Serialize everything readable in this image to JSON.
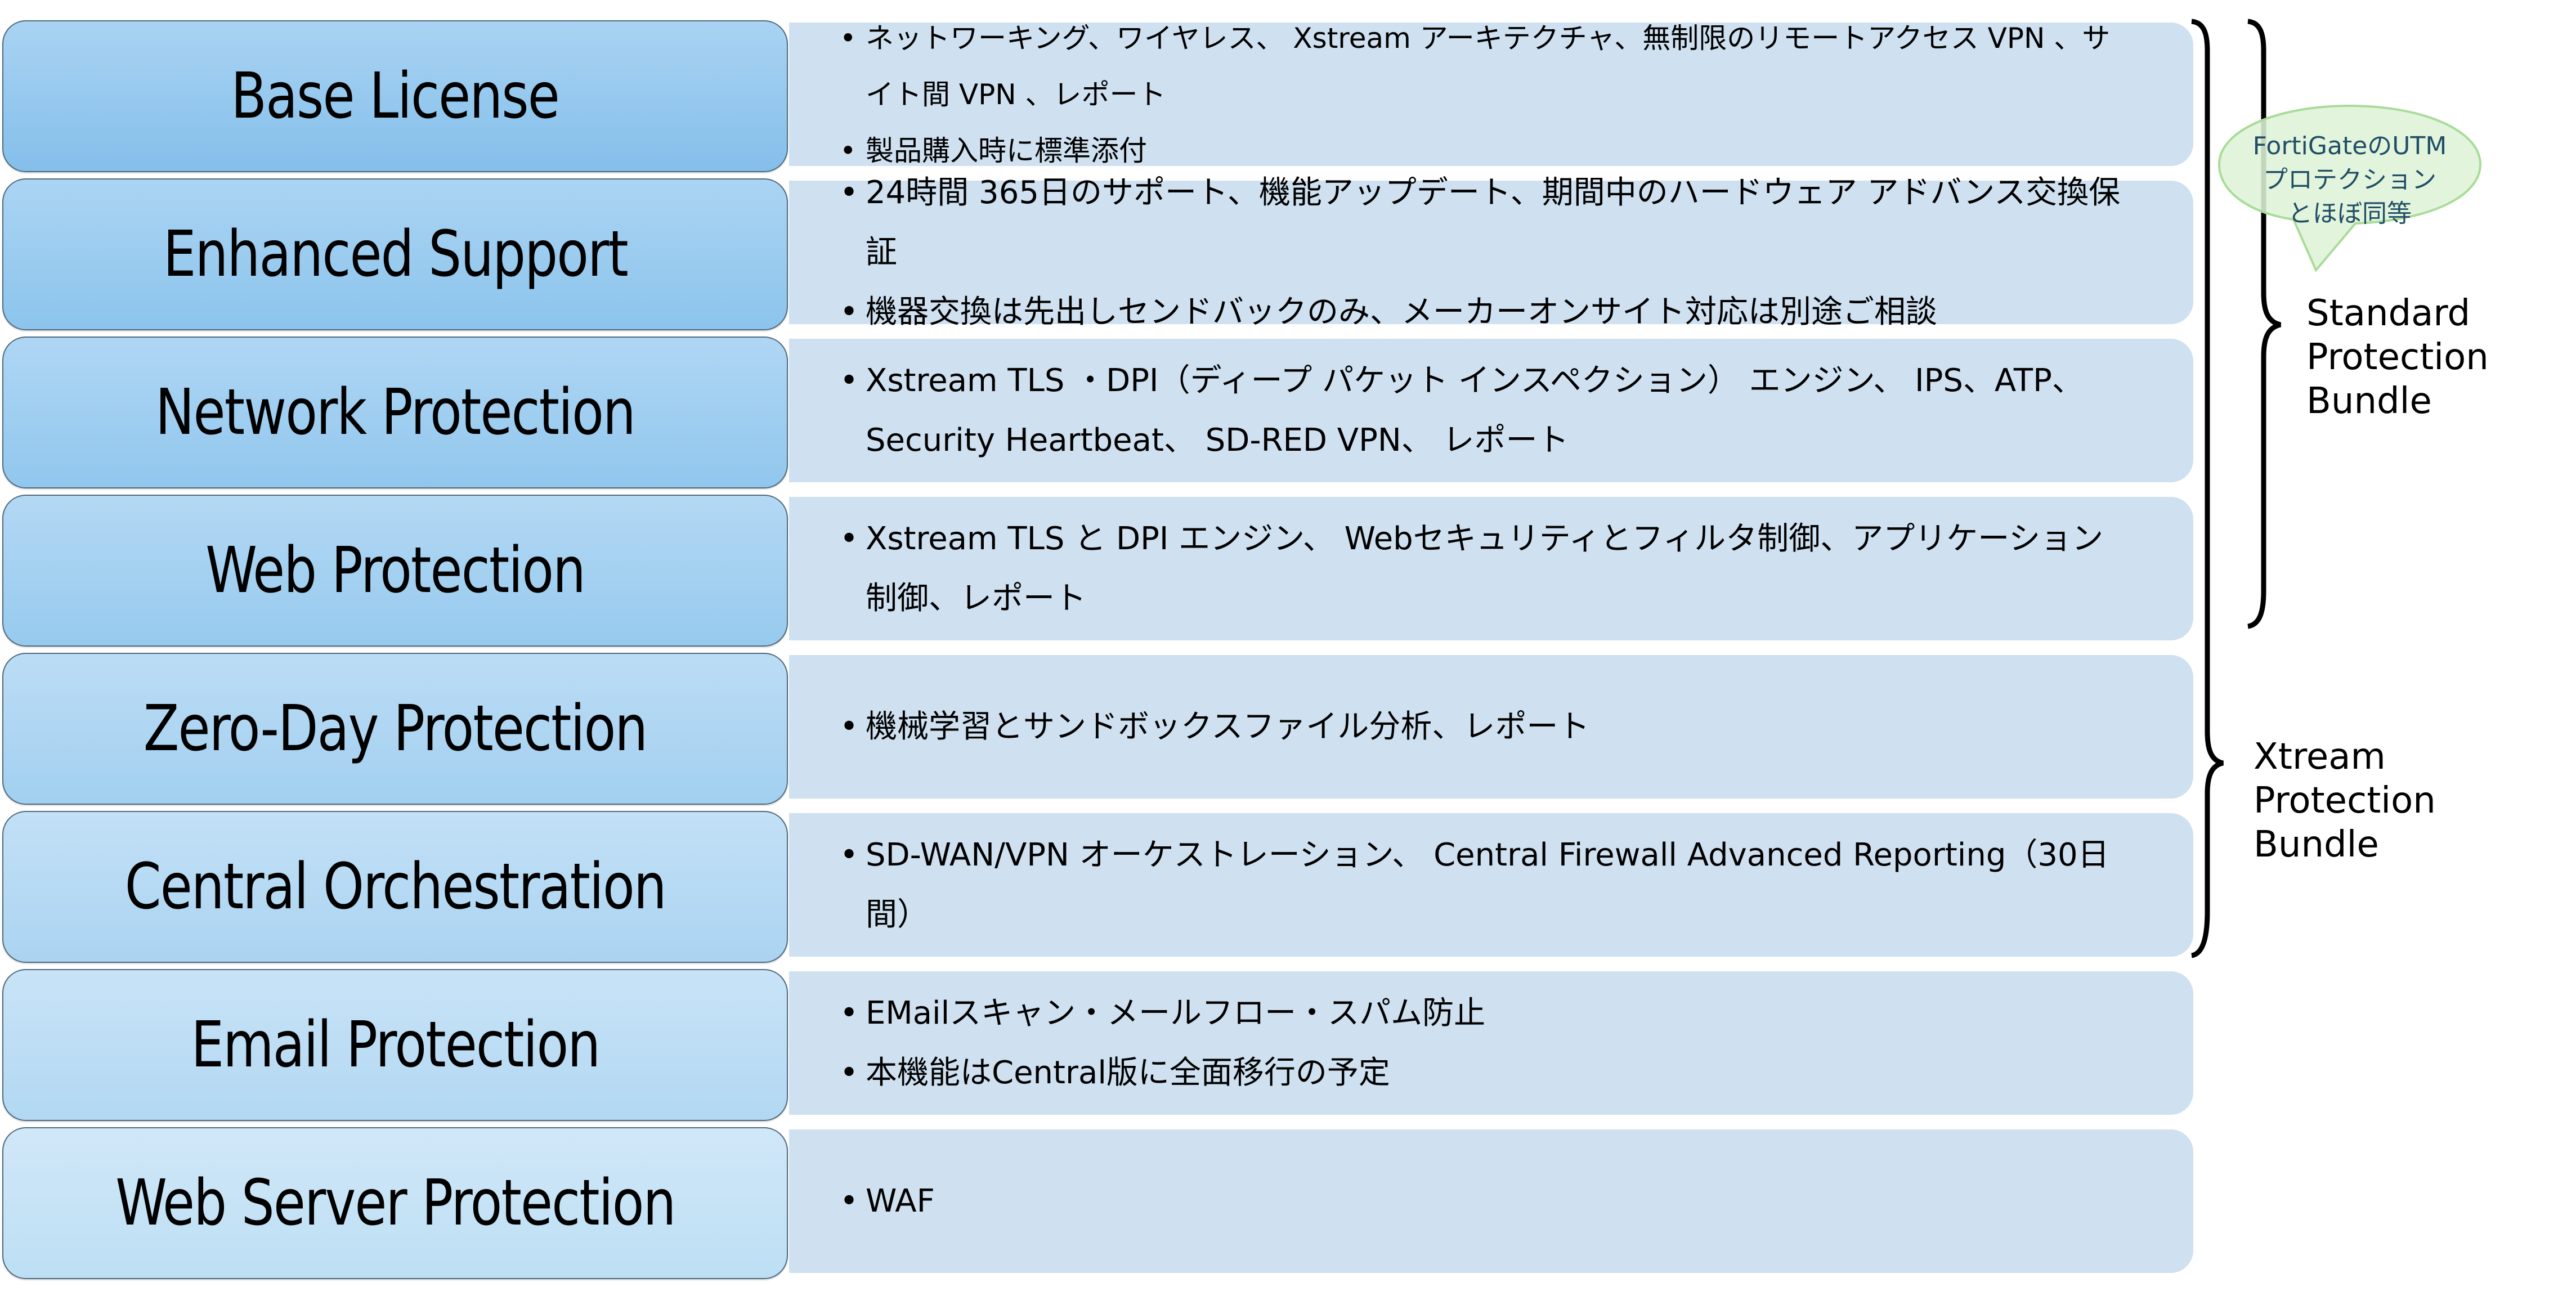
{
  "rows": [
    {
      "label": "Base License",
      "gradient": [
        "#a9d3f3",
        "#84bfea"
      ],
      "bullets": [
        "ネットワーキング、ワイヤレス、 Xstream アーキテクチャ、無制限のリモートアクセス VPN 、サイト間 VPN 、レポート",
        "製品購入時に標準添付"
      ]
    },
    {
      "label": "Enhanced Support",
      "gradient": [
        "#abd4f3",
        "#8cc4ec"
      ],
      "bullets": [
        "24時間 365日のサポート、機能アップデート、期間中のハードウェア アドバンス交換保証",
        "機器交換は先出しセンドバックのみ、メーカーオンサイト対応は別途ご相談"
      ]
    },
    {
      "label": "Network Protection",
      "gradient": [
        "#afd6f4",
        "#91c7ed"
      ],
      "bullets": [
        "Xstream TLS ・DPI（ディープ パケット インスペクション） エンジン、 IPS、ATP、Security Heartbeat、 SD-RED VPN、 レポート"
      ]
    },
    {
      "label": "Web Protection",
      "gradient": [
        "#b3d8f4",
        "#97caee"
      ],
      "bullets": [
        "Xstream TLS と DPI エンジン、 Webセキュリティとフィルタ制御、アプリケーション制御、レポート"
      ]
    },
    {
      "label": "Zero-Day Protection",
      "gradient": [
        "#bcdcf5",
        "#a2d0f0"
      ],
      "bullets": [
        "機械学習とサンドボックスファイル分析、レポート"
      ]
    },
    {
      "label": "Central Orchestration",
      "gradient": [
        "#c2e0f6",
        "#abd4f1"
      ],
      "bullets": [
        "SD-WAN/VPN オーケストレーション、 Central Firewall Advanced Reporting（30日間）"
      ]
    },
    {
      "label": "Email Protection",
      "gradient": [
        "#c8e3f7",
        "#b2d8f2"
      ],
      "bullets": [
        "EMailスキャン・メールフロー・スパム防止",
        "本機能はCentral版に全面移行の予定"
      ]
    },
    {
      "label": "Web Server Protection",
      "gradient": [
        "#d0e7f8",
        "#bddff4"
      ],
      "bullets": [
        "WAF"
      ]
    }
  ],
  "bundles": {
    "standard": {
      "label_lines": [
        "Standard",
        "Protection",
        "Bundle"
      ],
      "covers_rows": 4
    },
    "xtream": {
      "label_lines": [
        "Xtream",
        "Protection",
        "Bundle"
      ],
      "covers_rows": 6
    }
  },
  "callout": {
    "lines": [
      "FortiGateのUTM",
      "プロテクション",
      "とほぼ同等"
    ],
    "fill": "#dff3d8",
    "stroke": "#a8dc98",
    "text_color": "#1f4e66"
  },
  "colors": {
    "panel": "#cfe0f0",
    "label_border": "#4f6a80"
  }
}
